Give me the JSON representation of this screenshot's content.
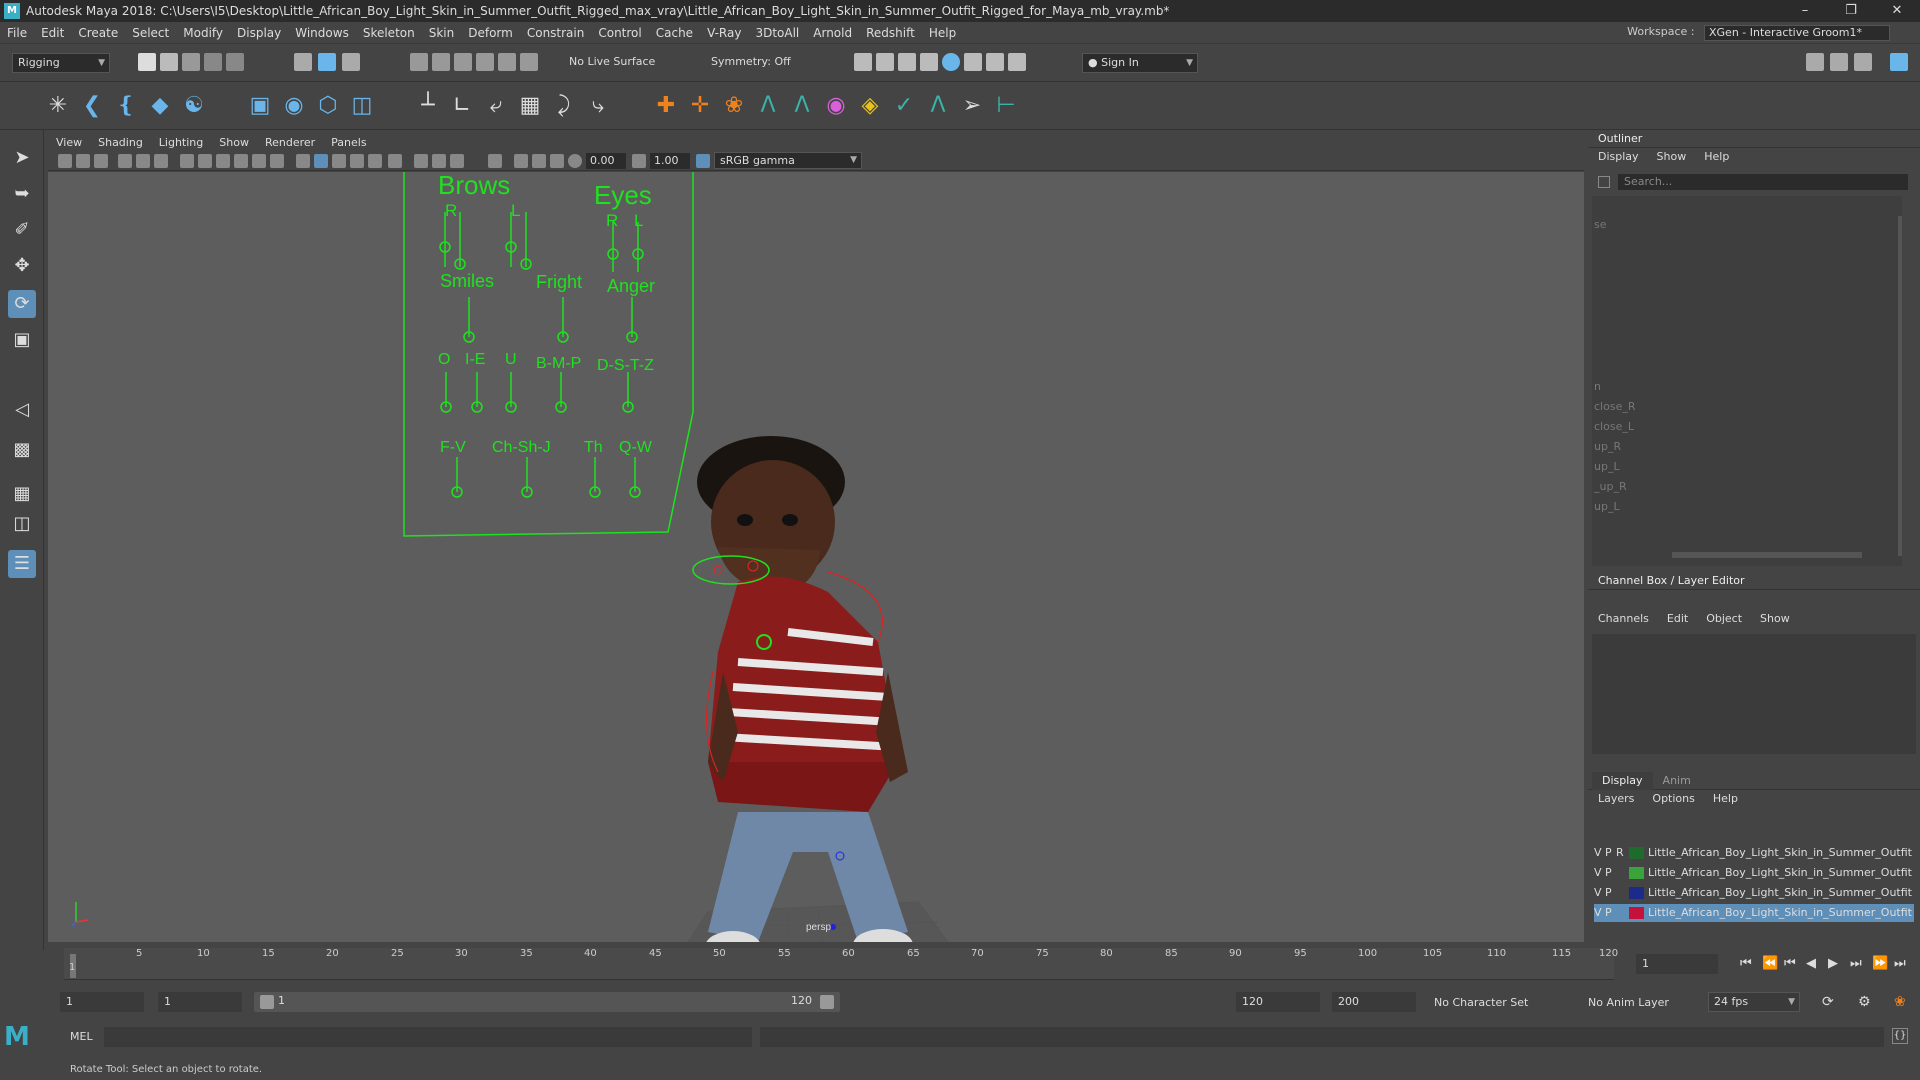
{
  "window": {
    "title": "Autodesk Maya 2018: C:\\Users\\I5\\Desktop\\Little_African_Boy_Light_Skin_in_Summer_Outfit_Rigged_max_vray\\Little_African_Boy_Light_Skin_in_Summer_Outfit_Rigged_for_Maya_mb_vray.mb*",
    "app_icon": "M"
  },
  "menubar": [
    "File",
    "Edit",
    "Create",
    "Select",
    "Modify",
    "Display",
    "Windows",
    "Skeleton",
    "Skin",
    "Deform",
    "Constrain",
    "Control",
    "Cache",
    "V-Ray",
    "3DtoAll",
    "Arnold",
    "Redshift",
    "Help"
  ],
  "workspace": {
    "label": "Workspace :",
    "value": "XGen - Interactive Groom1*"
  },
  "statusline": {
    "menu_set": "Rigging",
    "live_surface": "No Live Surface",
    "symmetry": "Symmetry: Off",
    "sign_in": "Sign In"
  },
  "viewport": {
    "menus": [
      "View",
      "Shading",
      "Lighting",
      "Show",
      "Renderer",
      "Panels"
    ],
    "exposure": "0.00",
    "gamma": "1.00",
    "color_space": "sRGB gamma",
    "camera_label": "persp",
    "colors": {
      "rig": "#1ee21e",
      "background": "#5d5d5d"
    }
  },
  "facial_rig": {
    "brows": "Brows",
    "eyes": "Eyes",
    "r1": "R",
    "l1": "L",
    "r2": "R",
    "l2": "L",
    "smiles": "Smiles",
    "fright": "Fright",
    "anger": "Anger",
    "o": "O",
    "i_e": "I-E",
    "u": "U",
    "bmp": "B-M-P",
    "dstz": "D-S-T-Z",
    "fv": "F-V",
    "chshj": "Ch-Sh-J",
    "th": "Th",
    "qw": "Q-W"
  },
  "outliner": {
    "title": "Outliner",
    "menus": [
      "Display",
      "Show",
      "Help"
    ],
    "search_placeholder": "Search...",
    "items": [
      "se",
      "n",
      "close_R",
      "close_L",
      "up_R",
      "up_L",
      "_up_R",
      "up_L"
    ]
  },
  "channel_box": {
    "title": "Channel Box / Layer Editor",
    "menus": [
      "Channels",
      "Edit",
      "Object",
      "Show"
    ]
  },
  "layer_editor": {
    "tabs": [
      "Display",
      "Anim"
    ],
    "menus": [
      "Layers",
      "Options",
      "Help"
    ],
    "layers": [
      {
        "v": "V",
        "p": "P",
        "r": "R",
        "color": "#1f6b2b",
        "name": "Little_African_Boy_Light_Skin_in_Summer_Outfit"
      },
      {
        "v": "V",
        "p": "P",
        "r": "",
        "color": "#3aa33a",
        "name": "Little_African_Boy_Light_Skin_in_Summer_Outfit"
      },
      {
        "v": "V",
        "p": "P",
        "r": "",
        "color": "#1c2a8a",
        "name": "Little_African_Boy_Light_Skin_in_Summer_Outfit"
      },
      {
        "v": "V",
        "p": "P",
        "r": "",
        "color": "#c4123a",
        "name": "Little_African_Boy_Light_Skin_in_Summer_Outfit"
      }
    ]
  },
  "timeline": {
    "ticks": [
      "1",
      "5",
      "10",
      "15",
      "20",
      "25",
      "30",
      "35",
      "40",
      "45",
      "50",
      "55",
      "60",
      "65",
      "70",
      "75",
      "80",
      "85",
      "90",
      "95",
      "100",
      "105",
      "110",
      "115",
      "120"
    ],
    "current_frame": "1"
  },
  "range": {
    "start": "1",
    "anim_start": "1",
    "range_start": "1",
    "range_end": "120",
    "end": "120",
    "anim_end": "200",
    "character_set": "No Character Set",
    "anim_layer": "No Anim Layer",
    "fps": "24 fps"
  },
  "command": {
    "lang": "MEL",
    "help": "Rotate Tool: Select an object to rotate."
  }
}
